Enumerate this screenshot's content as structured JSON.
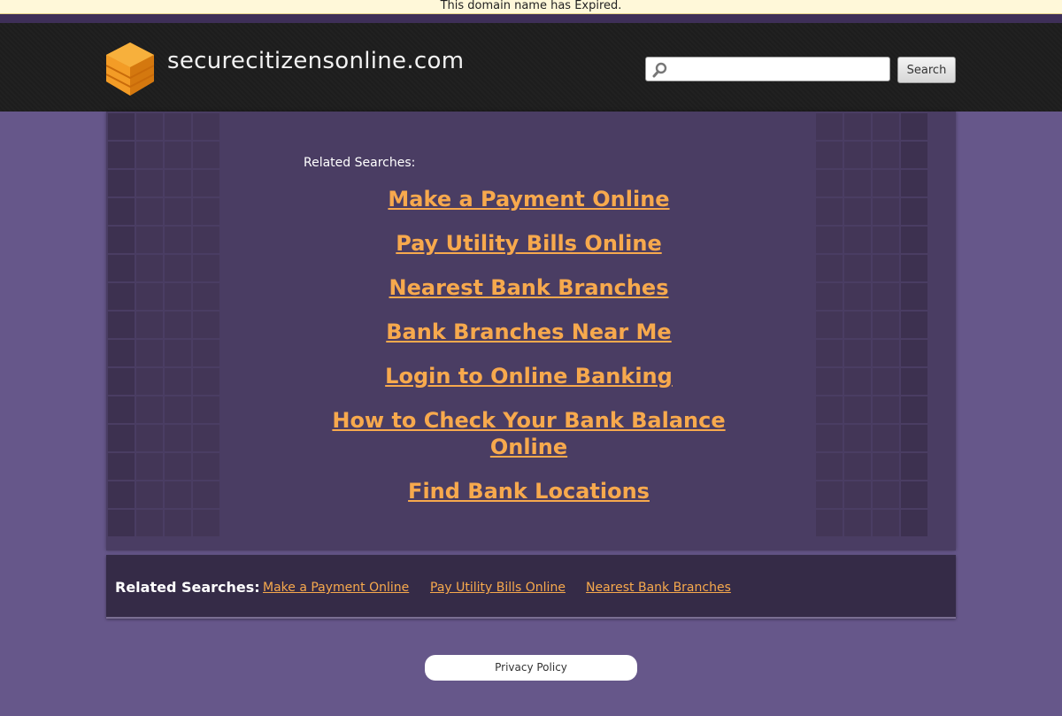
{
  "notice": {
    "text": "This domain name has Expired."
  },
  "header": {
    "site_name": "securecitizensonline.com",
    "search": {
      "placeholder": "",
      "value": "",
      "button_label": "Search"
    }
  },
  "main": {
    "related_title": "Related Searches:",
    "links": [
      "Make a Payment Online",
      "Pay Utility Bills Online",
      "Nearest Bank Branches",
      "Bank Branches Near Me",
      "Login to Online Banking",
      "How to Check Your Bank Balance Online",
      "Find Bank Locations"
    ]
  },
  "footer": {
    "related_label": "Related Searches:",
    "links": [
      "Make a Payment Online",
      "Pay Utility Bills Online",
      "Nearest Bank Branches"
    ],
    "privacy_label": "Privacy Policy"
  },
  "colors": {
    "background": "#66578a",
    "header": "#1d1d1d",
    "panel": "#4a3d63",
    "link": "#f7a94d",
    "logo": "#f39c26"
  }
}
